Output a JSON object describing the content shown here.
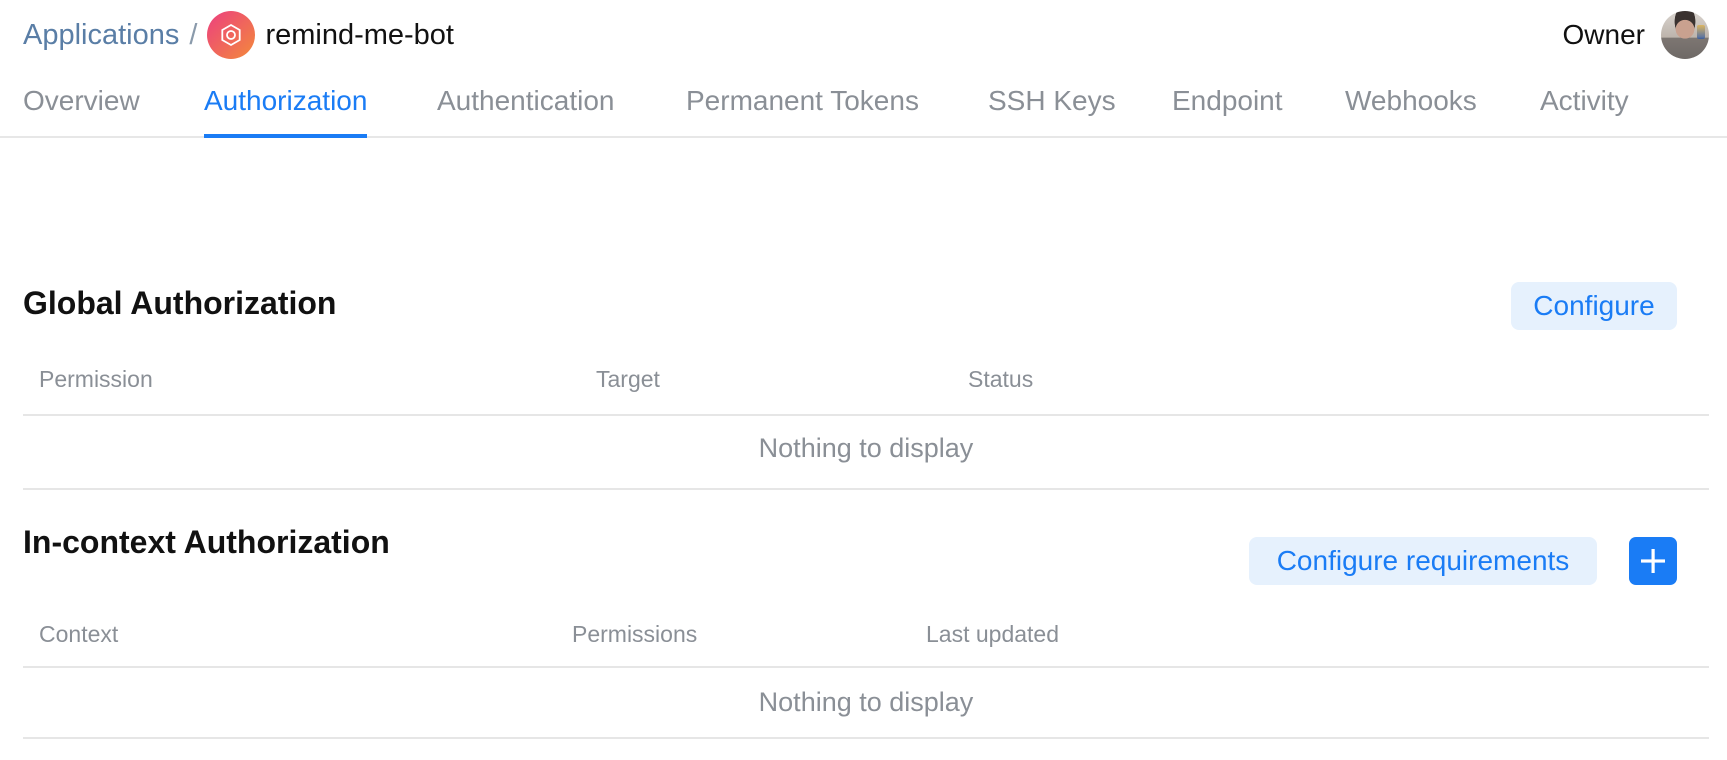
{
  "header": {
    "breadcrumb_root": "Applications",
    "separator": "/",
    "app_name": "remind-me-bot",
    "app_icon": "hexagon-ring-icon",
    "app_icon_gradient": [
      "#ec3f80",
      "#f38a3a"
    ],
    "role": "Owner",
    "avatar": "user-avatar-photo"
  },
  "tabs": [
    {
      "label": "Overview",
      "active": false
    },
    {
      "label": "Authorization",
      "active": true
    },
    {
      "label": "Authentication",
      "active": false
    },
    {
      "label": "Permanent Tokens",
      "active": false
    },
    {
      "label": "SSH Keys",
      "active": false
    },
    {
      "label": "Endpoint",
      "active": false
    },
    {
      "label": "Webhooks",
      "active": false
    },
    {
      "label": "Activity",
      "active": false
    }
  ],
  "global_authorization": {
    "title": "Global Authorization",
    "configure_label": "Configure",
    "columns": [
      "Permission",
      "Target",
      "Status"
    ],
    "rows": [],
    "empty_text": "Nothing to display"
  },
  "in_context_authorization": {
    "title": "In-context Authorization",
    "configure_label": "Configure requirements",
    "add_icon": "plus-icon",
    "columns": [
      "Context",
      "Permissions",
      "Last updated"
    ],
    "rows": [],
    "empty_text": "Nothing to display"
  },
  "colors": {
    "accent": "#1a7cf5",
    "accent_soft_bg": "#e6f1fd",
    "muted_text": "#8a8f96",
    "link": "#5a7ea6",
    "divider": "#e6e6e6"
  }
}
